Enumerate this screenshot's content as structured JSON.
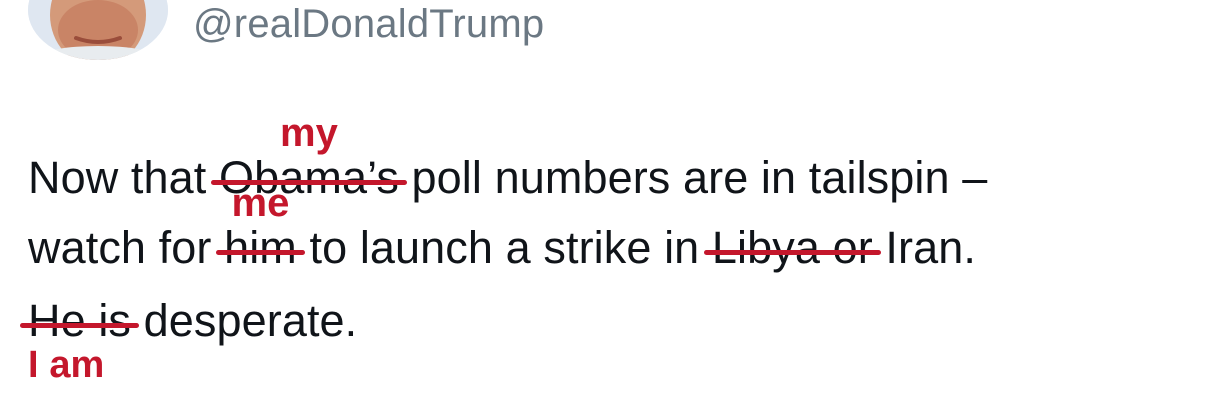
{
  "header": {
    "handle": "@realDonaldTrump"
  },
  "tweet": {
    "line1": {
      "before": "Now that ",
      "struck": "Obama’s",
      "correction": "my",
      "after": " poll numbers are in tailspin –"
    },
    "line2": {
      "before": "watch for ",
      "struck1": "him",
      "correction1": "me",
      "middle": " to launch a strike in ",
      "struck2": "Libya or",
      "after": " Iran."
    },
    "line3": {
      "struck": "He is",
      "correction": "I am",
      "after": " desperate."
    }
  },
  "colors": {
    "correction_red": "#c4172c",
    "handle_gray": "#6b7883",
    "text": "#101419"
  }
}
